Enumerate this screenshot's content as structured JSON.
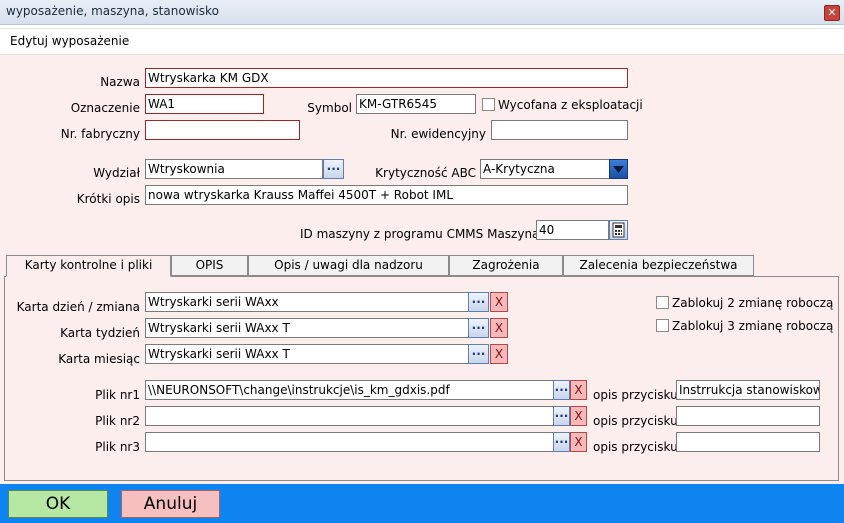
{
  "window": {
    "title": "wyposażenie, maszyna, stanowisko",
    "close_glyph": "✕"
  },
  "header": {
    "title": "Edytuj wyposażenie"
  },
  "form": {
    "nazwa_label": "Nazwa",
    "nazwa_value": "Wtryskarka KM GDX",
    "oznaczenie_label": "Oznaczenie",
    "oznaczenie_value": "WA1",
    "symbol_label": "Symbol",
    "symbol_value": "KM-GTR6545",
    "wycofana_label": "Wycofana z eksploatacji",
    "nr_fabryczny_label": "Nr. fabryczny",
    "nr_fabryczny_value": "",
    "nr_ewidencyjny_label": "Nr. ewidencyjny",
    "nr_ewidencyjny_value": "",
    "wydzial_label": "Wydział",
    "wydzial_value": "Wtryskownia",
    "krytycznosc_label": "Krytyczność ABC",
    "krytycznosc_value": "A-Krytyczna",
    "krotki_opis_label": "Krótki opis",
    "krotki_opis_value": "nowa wtryskarka Krauss Maffei 4500T + Robot IML",
    "id_maszyny_label": "ID maszyny z programu CMMS Maszyna",
    "id_maszyny_value": "40",
    "dots_label": "...",
    "x_label": "X"
  },
  "tabs": [
    {
      "label": "Karty kontrolne i pliki",
      "active": true
    },
    {
      "label": "OPIS"
    },
    {
      "label": "Opis / uwagi dla nadzoru"
    },
    {
      "label": "Zagrożenia"
    },
    {
      "label": "Zalecenia bezpieczeństwa"
    }
  ],
  "tab_content": {
    "karta_dzien_label": "Karta dzień / zmiana",
    "karta_dzien_value": "Wtryskarki serii WAxx",
    "karta_tydzien_label": "Karta tydzień",
    "karta_tydzien_value": "Wtryskarki serii WAxx T",
    "karta_miesiac_label": "Karta miesiąc",
    "karta_miesiac_value": "Wtryskarki serii WAxx T",
    "zablokuj2_label": "Zablokuj 2 zmianę roboczą",
    "zablokuj3_label": "Zablokuj 3 zmianę roboczą",
    "plik1_label": "Plik nr1",
    "plik1_value": "\\\\NEURONSOFT\\change\\instrukcje\\is_km_gdxis.pdf",
    "plik2_label": "Plik nr2",
    "plik2_value": "",
    "plik3_label": "Plik nr3",
    "plik3_value": "",
    "opis_przycisku_label": "opis przycisku",
    "opis1_value": "Instrrukcja stanowiskowa",
    "opis2_value": "",
    "opis3_value": ""
  },
  "buttons": {
    "ok": "OK",
    "cancel": "Anuluj"
  },
  "colors": {
    "form_bg": "#fbeeed",
    "bottom_bar": "#0d84f0",
    "ok_bg": "#b6e8a4",
    "cancel_bg": "#f6c0c0"
  }
}
